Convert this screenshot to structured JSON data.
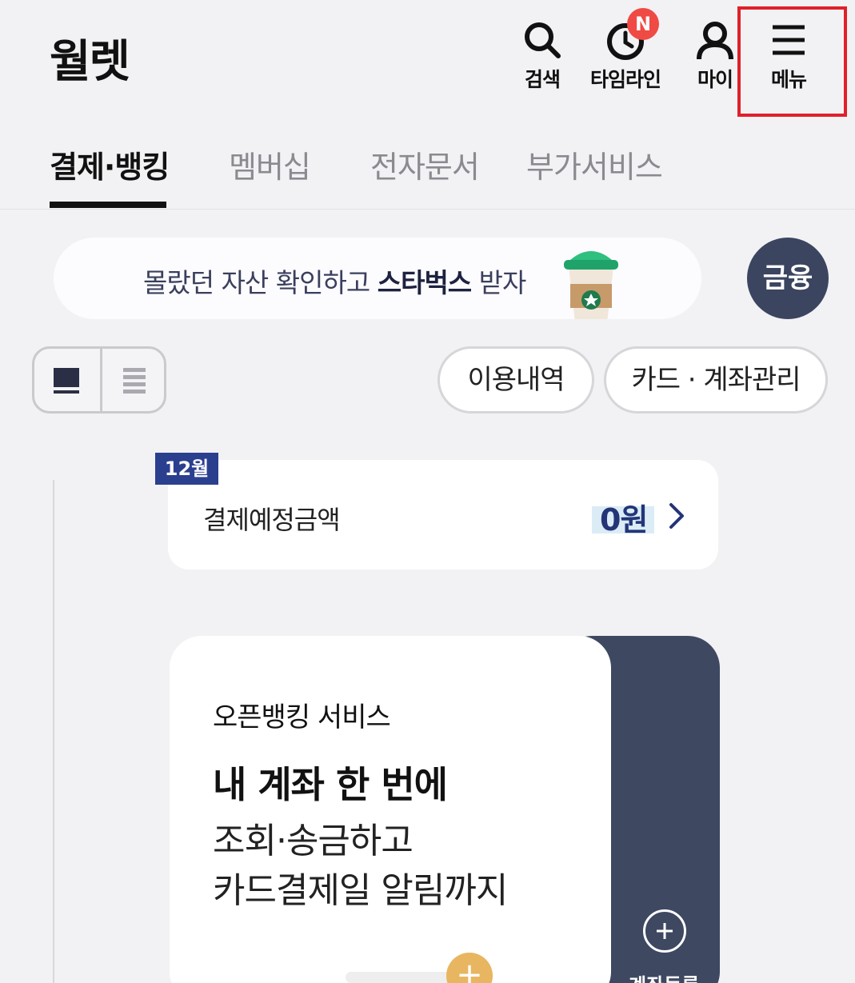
{
  "header": {
    "title": "월렛",
    "search_label": "검색",
    "timeline_label": "타임라인",
    "timeline_badge": "N",
    "my_label": "마이",
    "menu_label": "메뉴"
  },
  "tabs": [
    {
      "label": "결제·뱅킹",
      "active": true
    },
    {
      "label": "멤버십",
      "active": false
    },
    {
      "label": "전자문서",
      "active": false
    },
    {
      "label": "부가서비스",
      "active": false
    }
  ],
  "promo": {
    "text_before": "몰랐던 자산 확인하고 ",
    "text_bold": "스타벅스",
    "text_after": " 받자",
    "finance_button": "금융"
  },
  "toolbar": {
    "history_button": "이용내역",
    "manage_button": "카드 · 계좌관리"
  },
  "payment": {
    "month": "12월",
    "label": "결제예정금액",
    "amount": "0원"
  },
  "open_banking": {
    "subtitle": "오픈뱅킹 서비스",
    "title": "내 계좌 한 번에",
    "line1": "조회·송금하고",
    "line2": "카드결제일 알림까지",
    "coin_symbol": "+",
    "add_account_label": "계좌등록"
  },
  "colors": {
    "accent_navy": "#2b3f8f",
    "card_dark": "#3e4861",
    "badge_red": "#f04a44",
    "highlight_red": "#e0202a"
  }
}
